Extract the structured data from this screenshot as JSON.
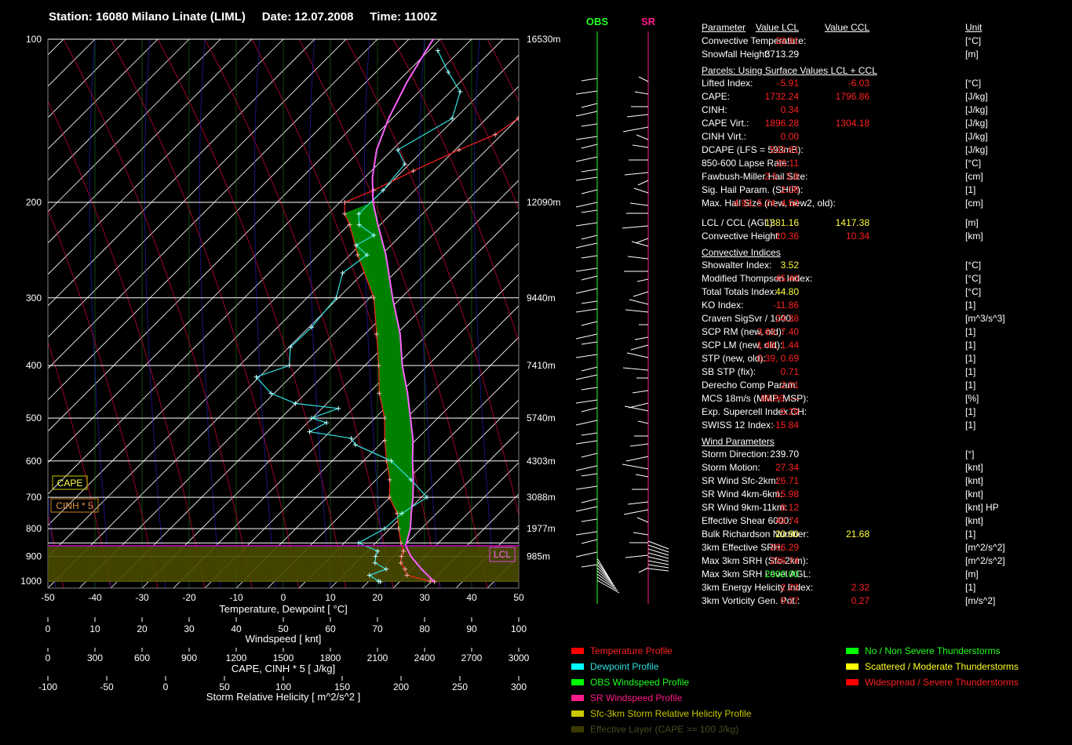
{
  "header": {
    "station": "Station: 16080 Milano Linate (LIML)",
    "date": "Date: 12.07.2008",
    "time": "Time: 1100Z"
  },
  "colors": {
    "temperature": "#ff2020",
    "dewpoint": "#30e0e0",
    "obs_wind": "#20ff20",
    "sr_wind": "#ff1a8c",
    "helicity": "#c8c800",
    "cape_fill": "#008000",
    "effective_layer": "#4a4a00",
    "dry_adiabat": "#c00030",
    "moist_adiabat": "#2020c0",
    "mixing_ratio": "#208020"
  },
  "chart_data": {
    "type": "line",
    "title": "Station: 16080 Milano Linate (LIML)   Date: 12.07.2008   Time: 1100Z",
    "xlabel": "Temperature, Dewpoint [ °C]",
    "x_ticks": [
      -50,
      -40,
      -30,
      -20,
      -10,
      0,
      10,
      20,
      30,
      40,
      50
    ],
    "xlim": [
      -50,
      50
    ],
    "pressure_ticks": [
      100,
      200,
      300,
      400,
      500,
      600,
      700,
      800,
      900,
      1000
    ],
    "ylim_hpa": [
      1030,
      100
    ],
    "height_labels": [
      {
        "p": 100,
        "label": "16530m"
      },
      {
        "p": 200,
        "label": "12090m"
      },
      {
        "p": 300,
        "label": "9440m"
      },
      {
        "p": 400,
        "label": "7410m"
      },
      {
        "p": 500,
        "label": "5740m"
      },
      {
        "p": 600,
        "label": "4303m"
      },
      {
        "p": 700,
        "label": "3088m"
      },
      {
        "p": 800,
        "label": "1977m"
      },
      {
        "p": 900,
        "label": "985m"
      }
    ],
    "horizontal_lines_hpa": [
      100,
      200,
      300,
      400,
      500,
      600,
      700,
      800,
      850,
      900,
      1000
    ],
    "lcl_hpa": 860,
    "series": [
      {
        "name": "Temperature Profile",
        "color_key": "temperature",
        "p": [
          1003,
          1000,
          975,
          950,
          925,
          900,
          880,
          850,
          800,
          750,
          700,
          650,
          600,
          550,
          500,
          450,
          400,
          350,
          300,
          250,
          220,
          210,
          200,
          190,
          175,
          160,
          150,
          140,
          130,
          120,
          110,
          105
        ],
        "t": [
          31.0,
          30.0,
          24.0,
          22.5,
          20.5,
          19.5,
          19.0,
          17.0,
          14.0,
          11.0,
          6.5,
          3.5,
          -0.5,
          -4.5,
          -8.5,
          -14.0,
          -19.0,
          -25.0,
          -32.0,
          -43.0,
          -50.0,
          -53.0,
          -55.0,
          -51.0,
          -46.0,
          -40.0,
          -35.0,
          -33.0,
          -29.0,
          -27.0,
          -25.0,
          -22.5
        ]
      },
      {
        "name": "Dewpoint Profile",
        "color_key": "dewpoint",
        "p": [
          1003,
          1000,
          975,
          950,
          925,
          900,
          880,
          850,
          800,
          750,
          700,
          650,
          600,
          560,
          545,
          530,
          510,
          500,
          480,
          470,
          450,
          420,
          400,
          370,
          340,
          300,
          270,
          250,
          240,
          230,
          220,
          210,
          190,
          170,
          160,
          140,
          125,
          115,
          105
        ],
        "t": [
          19.5,
          19.0,
          16.0,
          18.5,
          15.0,
          14.0,
          13.5,
          8.0,
          11.0,
          12.0,
          14.5,
          8.0,
          0.5,
          -10.0,
          -12.0,
          -22.0,
          -20.0,
          -24.0,
          -20.0,
          -30.0,
          -37.0,
          -43.0,
          -38.0,
          -41.0,
          -40.0,
          -40.0,
          -43.0,
          -41.0,
          -45.0,
          -43.0,
          -48.0,
          -50.0,
          -49.0,
          -49.0,
          -53.0,
          -47.0,
          -50.0,
          -56.0,
          -62.0
        ]
      },
      {
        "name": "Parcel",
        "color_key": "parcel",
        "p": [
          1003,
          950,
          900,
          860,
          800,
          750,
          700,
          650,
          600,
          550,
          500,
          450,
          400,
          350,
          300,
          250,
          220,
          200,
          180,
          160,
          140,
          120,
          105,
          100
        ],
        "t": [
          31.0,
          26.0,
          21.5,
          18.5,
          16.5,
          14.0,
          11.5,
          8.5,
          5.0,
          1.5,
          -3.0,
          -8.0,
          -14.0,
          -20.0,
          -28.0,
          -37.0,
          -44.0,
          -49.0,
          -53.5,
          -57.5,
          -60.5,
          -63.0,
          -64.5,
          -65.0
        ]
      }
    ],
    "wind_panel": {
      "columns": [
        "OBS",
        "SR"
      ],
      "obs_axis_offset": 0,
      "sr_axis_offset": 0
    }
  },
  "axes": {
    "temperature": {
      "label": "Temperature, Dewpoint [ °C]",
      "ticks": [
        "-50",
        "-40",
        "-30",
        "-20",
        "-10",
        "0",
        "10",
        "20",
        "30",
        "40",
        "50"
      ]
    },
    "windspeed": {
      "label": "Windspeed [ knt]",
      "ticks": [
        "0",
        "10",
        "20",
        "30",
        "40",
        "50",
        "60",
        "70",
        "80",
        "90",
        "100"
      ]
    },
    "cape": {
      "label": "CAPE, CINH * 5 [ J/kg]",
      "ticks": [
        "0",
        "300",
        "600",
        "900",
        "1200",
        "1500",
        "1800",
        "2100",
        "2400",
        "2700",
        "3000"
      ]
    },
    "helicity": {
      "label": "Storm Relative Helicity [ m^2/s^2 ]",
      "ticks": [
        "-100",
        "-50",
        "0",
        "50",
        "100",
        "150",
        "200",
        "250",
        "300"
      ]
    }
  },
  "pressure_labels": [
    "100",
    "200",
    "300",
    "400",
    "500",
    "600",
    "700",
    "800",
    "900",
    "1000"
  ],
  "height_labels": [
    "16530m",
    "12090m",
    "9440m",
    "7410m",
    "5740m",
    "4303m",
    "3088m",
    "1977m",
    "985m"
  ],
  "badges": {
    "cape": "CAPE",
    "cinh": "CINH * 5",
    "lcl": "LCL"
  },
  "wind_headers": {
    "obs": "OBS",
    "sr": "SR"
  },
  "params": {
    "header": {
      "name": "Parameter",
      "v1": "Value LCL",
      "v2": "Value CCL",
      "unit": "Unit"
    },
    "rows": [
      {
        "name": "Convective Temperature:",
        "v1": "28.91",
        "c1": "r",
        "v2": "",
        "c2": "",
        "unit": "[°C]"
      },
      {
        "name": "Snowfall Height:",
        "v1": "3713.29",
        "c1": "w",
        "v2": "",
        "c2": "",
        "unit": "[m]"
      },
      {
        "section": "Parcels: Using Surface Values LCL + CCL"
      },
      {
        "name": "Lifted Index:",
        "v1": "-5.91",
        "c1": "r",
        "v2": "-6.03",
        "c2": "r",
        "unit": "[°C]"
      },
      {
        "name": "CAPE:",
        "v1": "1732.24",
        "c1": "r",
        "v2": "1796.86",
        "c2": "r",
        "unit": "[J/kg]"
      },
      {
        "name": "CINH:",
        "v1": "0.34",
        "c1": "r",
        "v2": "",
        "c2": "",
        "unit": "[J/kg]"
      },
      {
        "name": "CAPE Virt.:",
        "v1": "1896.28",
        "c1": "r",
        "v2": "1304.18",
        "c2": "r",
        "unit": "[J/kg]"
      },
      {
        "name": "CINH Virt.:",
        "v1": "0.00",
        "c1": "r",
        "v2": "",
        "c2": "",
        "unit": "[J/kg]"
      },
      {
        "name": "DCAPE (LFS = 593mB):",
        "v1": "532.81",
        "c1": "r",
        "v2": "",
        "c2": "",
        "unit": "[J/kg]"
      },
      {
        "name": "850-600 Lapse Rate:",
        "v1": "20.11",
        "c1": "r",
        "v2": "",
        "c2": "",
        "unit": "[°C]"
      },
      {
        "name": "Fawbush-Miller Hail Size:",
        "v1": "2.5 - 3.8",
        "c1": "r",
        "v2": "",
        "c2": "",
        "unit": "[cm]"
      },
      {
        "name": "Sig. Hail Param. (SHIP):",
        "v1": "2.08",
        "c1": "r",
        "v2": "",
        "c2": "",
        "unit": "[1]"
      },
      {
        "name": "Max. Hail Size (new, new2, old):",
        "v1": "4.93,  5.74,  4.50",
        "c1": "r",
        "v2": "",
        "c2": "",
        "unit": "[cm]"
      },
      {
        "spacer": true
      },
      {
        "name": "LCL / CCL (AGL):",
        "v1": "1381.16",
        "c1": "y",
        "v2": "1417.38",
        "c2": "y",
        "unit": "[m]"
      },
      {
        "name": "Convective Height:",
        "v1": "10.36",
        "c1": "r",
        "v2": "10.34",
        "c2": "r",
        "unit": "[km]"
      },
      {
        "section": "Convective Indices"
      },
      {
        "name": "Showalter Index:",
        "v1": "3.52",
        "c1": "y",
        "v2": "",
        "c2": "",
        "unit": "[°C]"
      },
      {
        "name": "Modified Thompson Index:",
        "v1": "45.40",
        "c1": "r",
        "v2": "",
        "c2": "",
        "unit": "[°C]"
      },
      {
        "name": "Total Totals Index:",
        "v1": "44.80",
        "c1": "y",
        "v2": "",
        "c2": "",
        "unit": "[°C]"
      },
      {
        "name": "KO Index:",
        "v1": "-11.86",
        "c1": "r",
        "v2": "",
        "c2": "",
        "unit": "[1]"
      },
      {
        "name": "Craven SigSvr / 1000:",
        "v1": "24.38",
        "c1": "r",
        "v2": "",
        "c2": "",
        "unit": "[m^3/s^3]"
      },
      {
        "name": "SCP RM (new, old):",
        "v1": "3.63,  7.40",
        "c1": "r",
        "v2": "",
        "c2": "",
        "unit": "[1]"
      },
      {
        "name": "SCP LM (new, old):",
        "v1": "1.48,  1.44",
        "c1": "r",
        "v2": "",
        "c2": "",
        "unit": "[1]"
      },
      {
        "name": "STP (new, old):",
        "v1": "0.39,  0.69",
        "c1": "r",
        "v2": "",
        "c2": "",
        "unit": "[1]"
      },
      {
        "name": "SB STP (fix):",
        "v1": "0.71",
        "c1": "r",
        "v2": "",
        "c2": "",
        "unit": "[1]"
      },
      {
        "name": "Derecho Comp Param:",
        "v1": "2.01",
        "c1": "r",
        "v2": "",
        "c2": "",
        "unit": "[1]"
      },
      {
        "name": "MCS 18m/s (MMP, MSP):",
        "v1": "86.96,  ---",
        "c1": "r",
        "v2": "",
        "c2": "",
        "unit": "[%]"
      },
      {
        "name": "Exp. Supercell Index CH:",
        "v1": "5.29",
        "c1": "r",
        "v2": "",
        "c2": "",
        "unit": "[1]"
      },
      {
        "name": "SWISS 12 Index:",
        "v1": "-15.84",
        "c1": "r",
        "v2": "",
        "c2": "",
        "unit": "[1]"
      },
      {
        "section": "Wind Parameters"
      },
      {
        "name": "Storm Direction:",
        "v1": "239.70",
        "c1": "w",
        "v2": "",
        "c2": "",
        "unit": "[°]"
      },
      {
        "name": "Storm Motion:",
        "v1": "27.34",
        "c1": "r",
        "v2": "",
        "c2": "",
        "unit": "[knt]"
      },
      {
        "name": "SR Wind Sfc-2km:",
        "v1": "26.71",
        "c1": "r",
        "v2": "",
        "c2": "",
        "unit": "[knt]"
      },
      {
        "name": "SR Wind 4km-6km:",
        "v1": "15.98",
        "c1": "r",
        "v2": "",
        "c2": "",
        "unit": "[knt]"
      },
      {
        "name": "SR Wind 9km-11km:",
        "v1": "8.12",
        "c1": "r",
        "v2": "",
        "c2": "",
        "unit": "[knt] HP"
      },
      {
        "name": "Effective Shear 6000:",
        "v1": "48.74",
        "c1": "r",
        "v2": "",
        "c2": "",
        "unit": "[knt]"
      },
      {
        "name": "Bulk Richardson Number:",
        "v1": "20.90",
        "c1": "y",
        "v2": "21.68",
        "c2": "y",
        "unit": "[1]"
      },
      {
        "name": "3km Effective SRH:",
        "v1": "206.29",
        "c1": "r",
        "v2": "",
        "c2": "",
        "unit": "[m^2/s^2]"
      },
      {
        "name": "Max 3km SRH (Sfc-2km):",
        "v1": "236.74",
        "c1": "r",
        "v2": "",
        "c2": "",
        "unit": "[m^2/s^2]"
      },
      {
        "name": "Max 3km SRH Level AGL:",
        "v1": "2000.00",
        "c1": "g",
        "v2": "",
        "c2": "",
        "unit": "[m]"
      },
      {
        "name": "3km Energy Helicity Index:",
        "v1": "2.23",
        "c1": "r",
        "v2": "2.32",
        "c2": "r",
        "unit": "[1]"
      },
      {
        "name": "3km Vorticity Gen. Pot.:",
        "v1": "0.27",
        "c1": "r",
        "v2": "0.27",
        "c2": "r",
        "unit": "[m/s^2]"
      }
    ]
  },
  "legend": {
    "left": [
      {
        "label": "Temperature Profile",
        "color": "#ff0000",
        "text_color": "#ff2020"
      },
      {
        "label": "Dewpoint Profile",
        "color": "#00ffff",
        "text_color": "#30e0e0"
      },
      {
        "label": "OBS Windspeed Profile",
        "color": "#00ff00",
        "text_color": "#20ff20"
      },
      {
        "label": "SR Windspeed Profile",
        "color": "#ff1a8c",
        "text_color": "#ff1a8c"
      },
      {
        "label": "Sfc-3km Storm Relative Helicity Profile",
        "color": "#c8c800",
        "text_color": "#c8c800"
      },
      {
        "label": "Effective Layer (CAPE >= 100 J/kg)",
        "color": "#3a3a00",
        "text_color": "#4a4a20"
      }
    ],
    "right": [
      {
        "label": "No / Non Severe Thunderstorms",
        "color": "#00ff00",
        "text_color": "#20ff20"
      },
      {
        "label": "Scattered / Moderate Thunderstorms",
        "color": "#ffff00",
        "text_color": "#ffff20"
      },
      {
        "label": "Widespread / Severe Thunderstorms",
        "color": "#ff0000",
        "text_color": "#ff2020"
      }
    ]
  }
}
